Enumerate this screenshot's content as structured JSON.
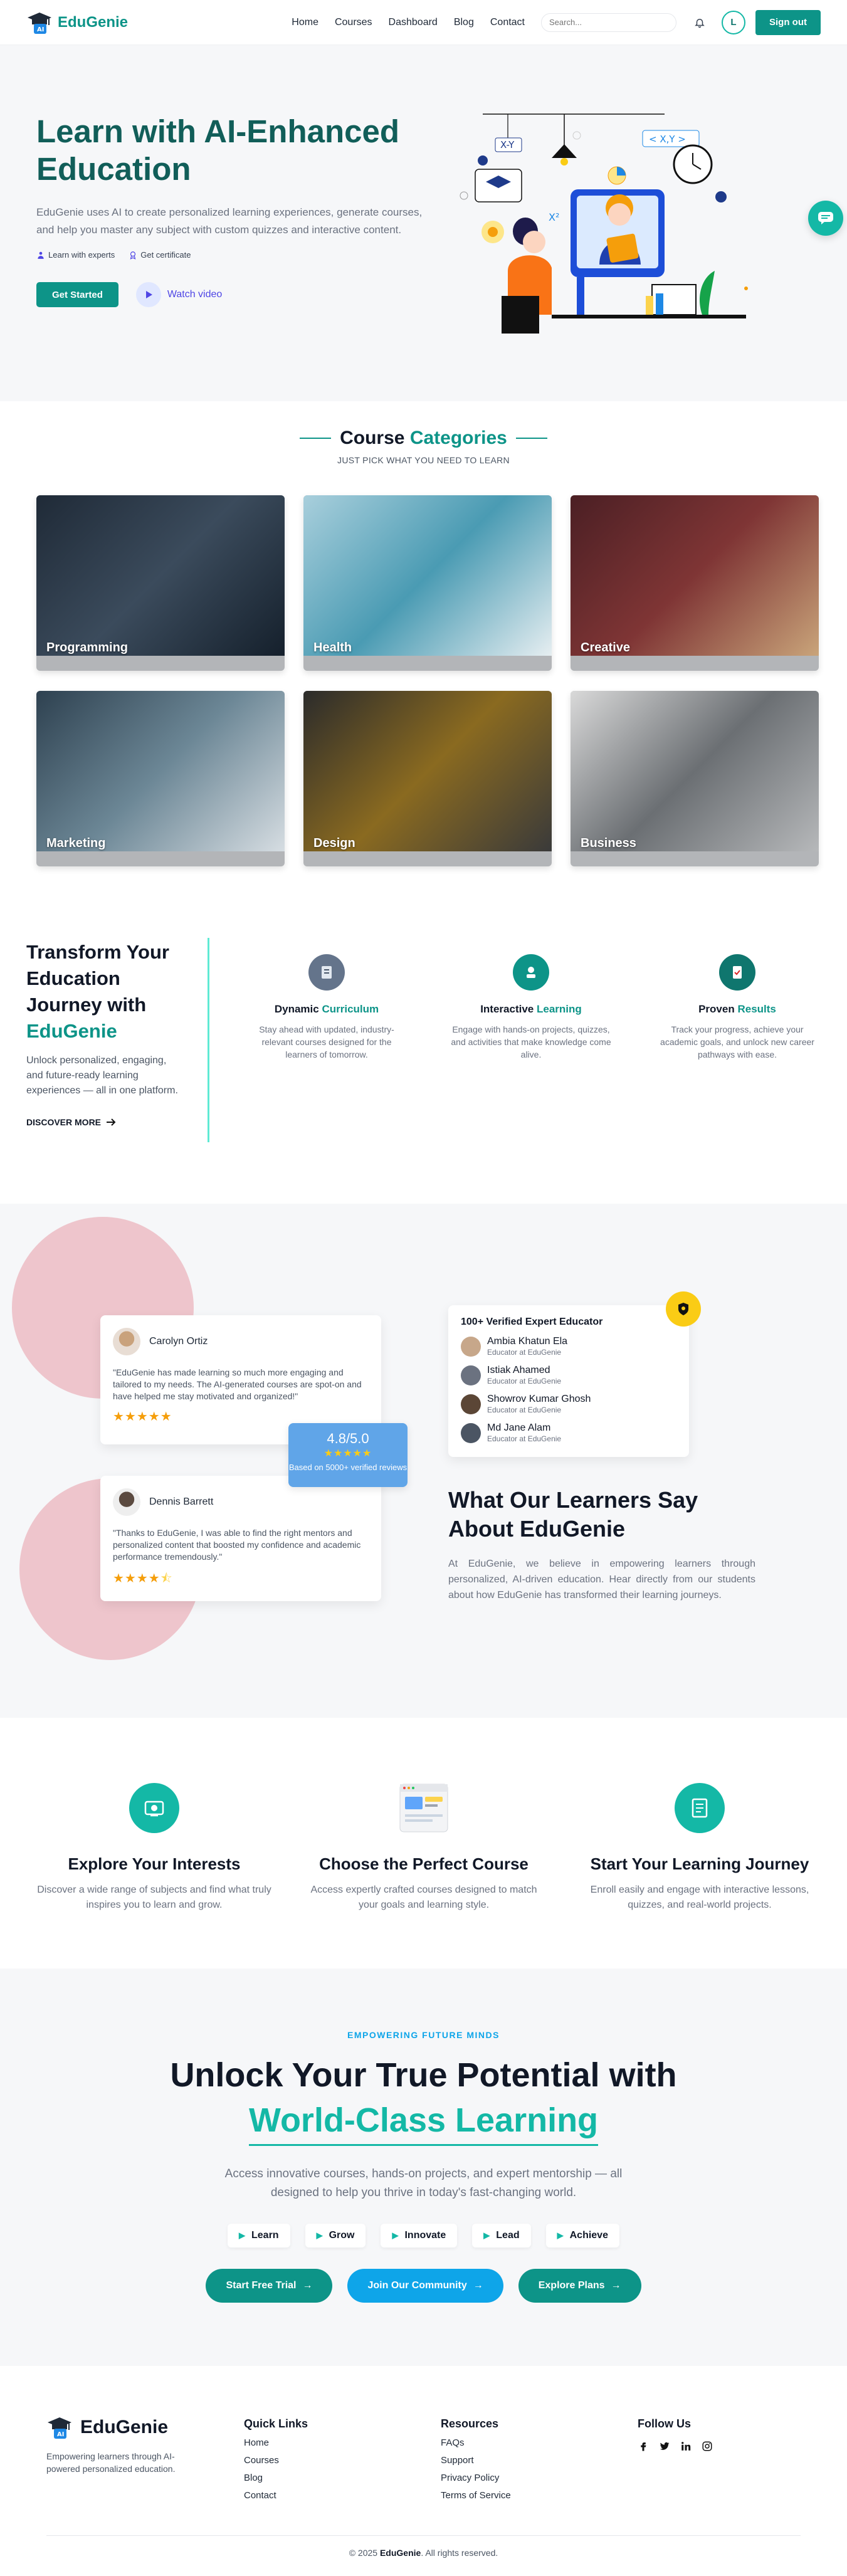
{
  "nav": {
    "brand": "EduGenie",
    "links": [
      "Home",
      "Courses",
      "Dashboard",
      "Blog",
      "Contact"
    ],
    "search_placeholder": "Search...",
    "avatar_initial": "L",
    "signout_label": "Sign out"
  },
  "hero": {
    "title": "Learn with AI-Enhanced Education",
    "description": "EduGenie uses AI to create personalized learning experiences, generate courses, and help you master any subject with custom quizzes and interactive content.",
    "badges": [
      "Learn with experts",
      "Get certificate"
    ],
    "start_label": "Get Started",
    "watch_label": "Watch video",
    "illus_labels": [
      "X-Y",
      "< X,Y >",
      "X²"
    ]
  },
  "categories": {
    "title_part1": "Course",
    "title_part2": "Categories",
    "subtitle": "JUST PICK WHAT YOU NEED TO LEARN",
    "items": [
      {
        "label": "Programming",
        "color": "#2c3a4a"
      },
      {
        "label": "Health",
        "color": "#6aa6b8"
      },
      {
        "label": "Creative",
        "color": "#6b3a3a"
      },
      {
        "label": "Marketing",
        "color": "#3f5566"
      },
      {
        "label": "Design",
        "color": "#3a3a3a"
      },
      {
        "label": "Business",
        "color": "#8a8d90"
      }
    ]
  },
  "transform": {
    "title": "Transform Your Education Journey with",
    "title_accent": "EduGenie",
    "description": "Unlock personalized, engaging, and future-ready learning experiences — all in one platform.",
    "link_label": "DISCOVER MORE",
    "features": [
      {
        "title_a": "Dynamic",
        "title_b": "Curriculum",
        "desc": "Stay ahead with updated, industry-relevant courses designed for the learners of tomorrow.",
        "icon": "curriculum-icon",
        "color": "#64748b"
      },
      {
        "title_a": "Interactive",
        "title_b": "Learning",
        "desc": "Engage with hands-on projects, quizzes, and activities that make knowledge come alive.",
        "icon": "interactive-icon",
        "color": "#0d9488"
      },
      {
        "title_a": "Proven",
        "title_b": "Results",
        "desc": "Track your progress, achieve your academic goals, and unlock new career pathways with ease.",
        "icon": "results-icon",
        "color": "#0f766e"
      }
    ]
  },
  "testimonials": {
    "reviews": [
      {
        "name": "Carolyn Ortiz",
        "text": "\"EduGenie has made learning so much more engaging and tailored to my needs. The AI-generated courses are spot-on and have helped me stay motivated and organized!\"",
        "stars": 5
      },
      {
        "name": "Dennis Barrett",
        "text": "\"Thanks to EduGenie, I was able to find the right mentors and personalized content that boosted my confidence and academic performance tremendously.\"",
        "stars": 4.5
      }
    ],
    "rating_value": "4.8/5.0",
    "rating_sub": "Based on 5000+ verified reviews",
    "experts_title": "100+ Verified Expert Educator",
    "experts": [
      {
        "name": "Ambia Khatun Ela",
        "role": "Educator at EduGenie"
      },
      {
        "name": "Istiak Ahamed",
        "role": "Educator at EduGenie"
      },
      {
        "name": "Showrov Kumar Ghosh",
        "role": "Educator at EduGenie"
      },
      {
        "name": "Md Jane Alam",
        "role": "Educator at EduGenie"
      }
    ],
    "title": "What Our Learners Say About EduGenie",
    "description": "At EduGenie, we believe in empowering learners through personalized, AI-driven education. Hear directly from our students about how EduGenie has transformed their learning journeys."
  },
  "steps": [
    {
      "title": "Explore Your Interests",
      "desc": "Discover a wide range of subjects and find what truly inspires you to learn and grow.",
      "icon": "explore-icon"
    },
    {
      "title": "Choose the Perfect Course",
      "desc": "Access expertly crafted courses designed to match your goals and learning style.",
      "icon": "course-browser-icon"
    },
    {
      "title": "Start Your Learning Journey",
      "desc": "Enroll easily and engage with interactive lessons, quizzes, and real-world projects.",
      "icon": "journey-icon"
    }
  ],
  "cta": {
    "kicker": "EMPOWERING FUTURE MINDS",
    "title": "Unlock Your True Potential with",
    "title_accent": "World-Class Learning",
    "description": "Access innovative courses, hands-on projects, and expert mentorship — all designed to help you thrive in today's fast-changing world.",
    "chips": [
      "Learn",
      "Grow",
      "Innovate",
      "Lead",
      "Achieve"
    ],
    "buttons": [
      {
        "label": "Start Free Trial",
        "color": "#0d9488"
      },
      {
        "label": "Join Our Community",
        "color": "#0ea5e9"
      },
      {
        "label": "Explore Plans",
        "color": "#0d9488"
      }
    ]
  },
  "footer": {
    "brand": "EduGenie",
    "tagline": "Empowering learners through AI-powered personalized education.",
    "quick_title": "Quick Links",
    "quick_links": [
      "Home",
      "Courses",
      "Blog",
      "Contact"
    ],
    "resources_title": "Resources",
    "resources": [
      "FAQs",
      "Support",
      "Privacy Policy",
      "Terms of Service"
    ],
    "follow_title": "Follow Us",
    "social": [
      "facebook-icon",
      "twitter-icon",
      "linkedin-icon",
      "instagram-icon"
    ],
    "copyright_prefix": "© 2025",
    "copyright_brand": "EduGenie",
    "copyright_suffix": ". All rights reserved."
  }
}
